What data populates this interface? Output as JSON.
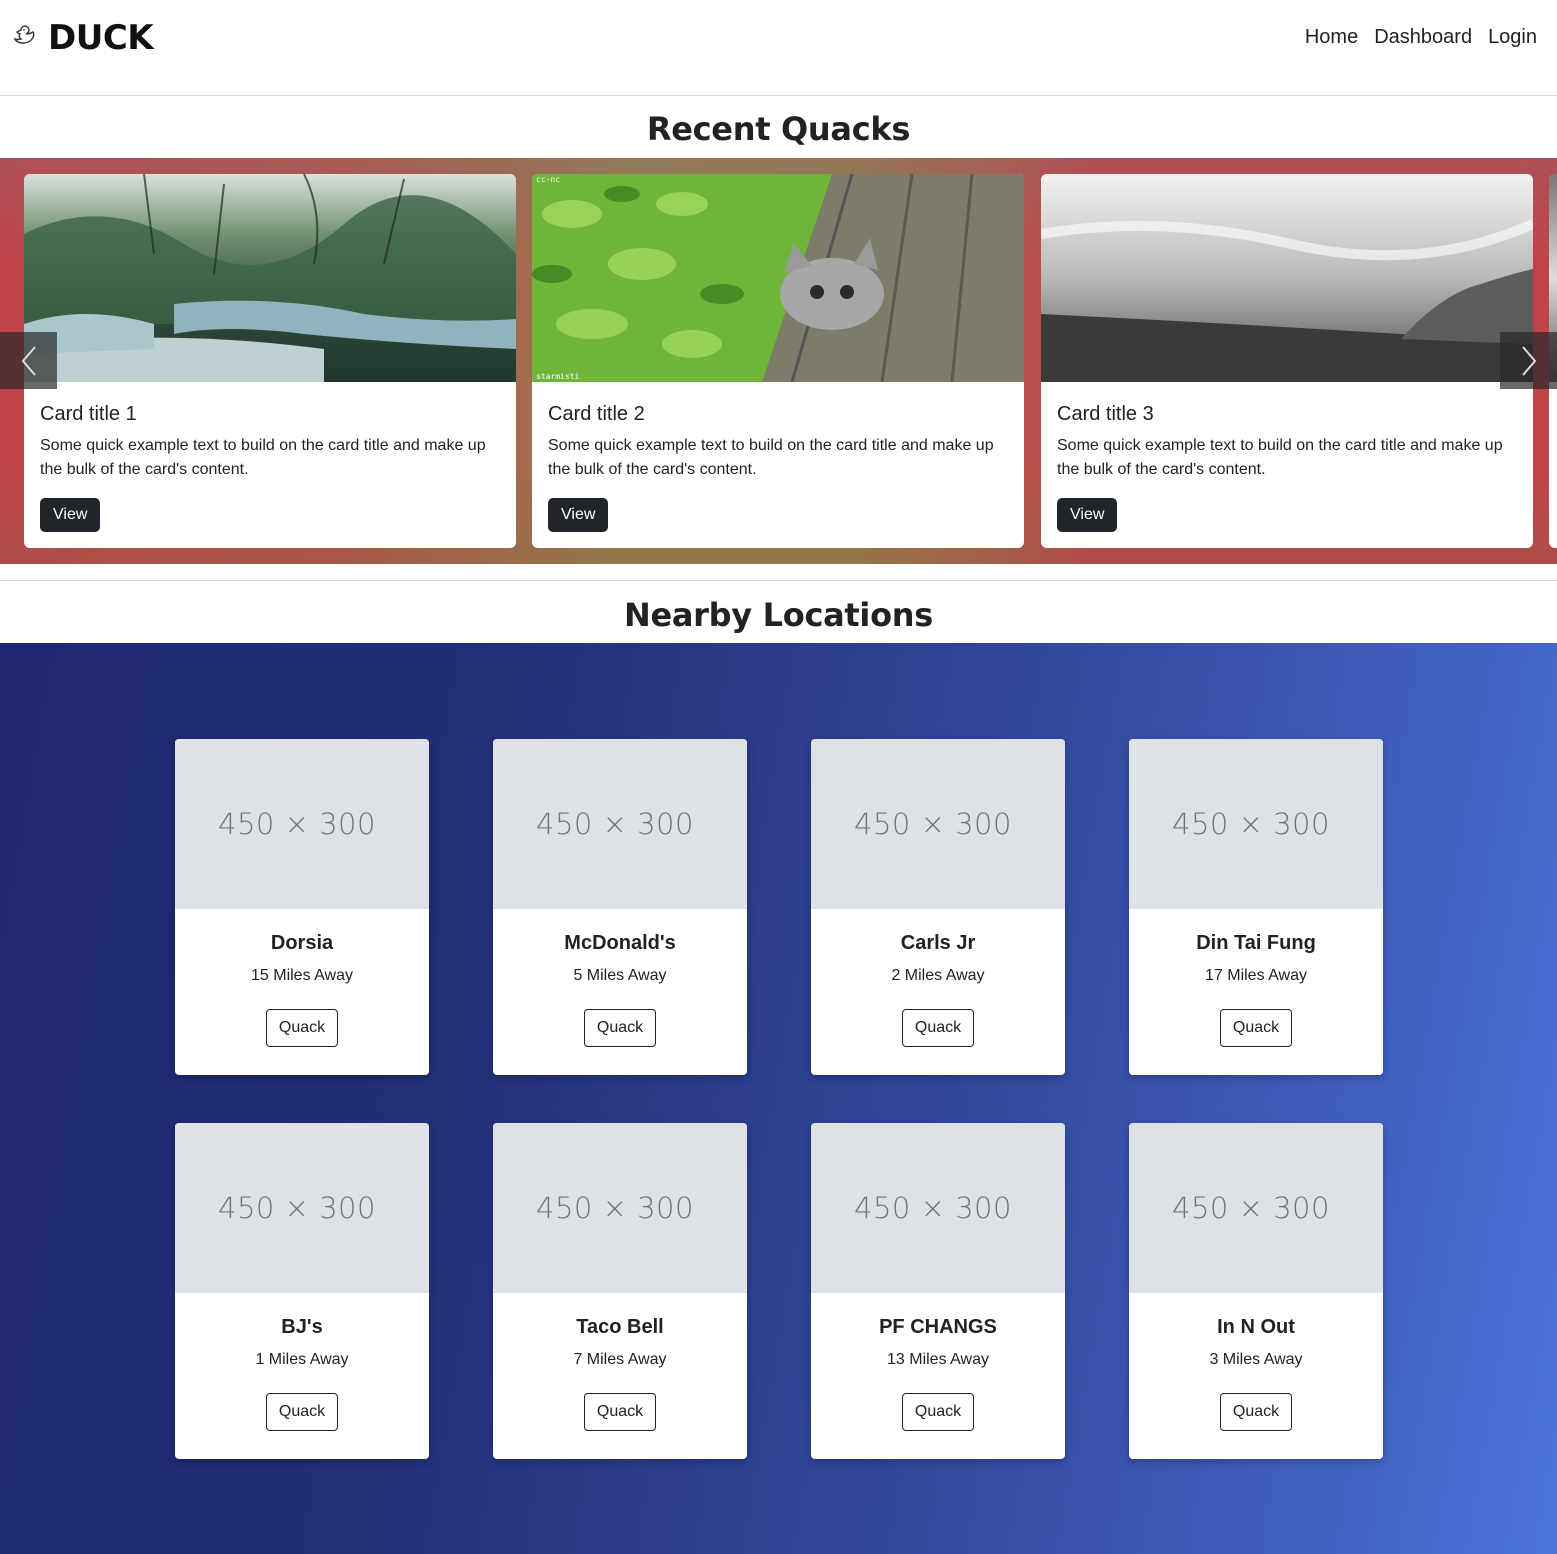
{
  "navbar": {
    "brand": "DUCK",
    "brand_icon": "duck-icon",
    "links": [
      "Home",
      "Dashboard",
      "Login"
    ]
  },
  "recent": {
    "title": "Recent Quacks",
    "cards": [
      {
        "title": "Card title 1",
        "text": "Some quick example text to build on the card title and make up the bulk of the card's content.",
        "button": "View",
        "image": "forest-stream-photo"
      },
      {
        "title": "Card title 2",
        "text": "Some quick example text to build on the card title and make up the bulk of the card's content.",
        "button": "View",
        "image": "kitten-in-tree-photo"
      },
      {
        "title": "Card title 3",
        "text": "Some quick example text to build on the card title and make up the bulk of the card's content.",
        "button": "View",
        "image": "grayscale-landscape-photo"
      }
    ],
    "prev_icon": "chevron-left-icon",
    "next_icon": "chevron-right-icon"
  },
  "nearby": {
    "title": "Nearby Locations",
    "placeholder": "450 × 300",
    "button": "Quack",
    "locations": [
      {
        "name": "Dorsia",
        "distance": "15 Miles Away"
      },
      {
        "name": "McDonald's",
        "distance": "5 Miles Away"
      },
      {
        "name": "Carls Jr",
        "distance": "2 Miles Away"
      },
      {
        "name": "Din Tai Fung",
        "distance": "17 Miles Away"
      },
      {
        "name": "BJ's",
        "distance": "1 Miles Away"
      },
      {
        "name": "Taco Bell",
        "distance": "7 Miles Away"
      },
      {
        "name": "PF CHANGS",
        "distance": "13 Miles Away"
      },
      {
        "name": "In N Out",
        "distance": "3 Miles Away"
      }
    ]
  },
  "colors": {
    "carousel_band": "#c0434a",
    "nearby_band_start": "#1f2870",
    "nearby_band_end": "#4b73d9",
    "dark_button": "#212529"
  }
}
